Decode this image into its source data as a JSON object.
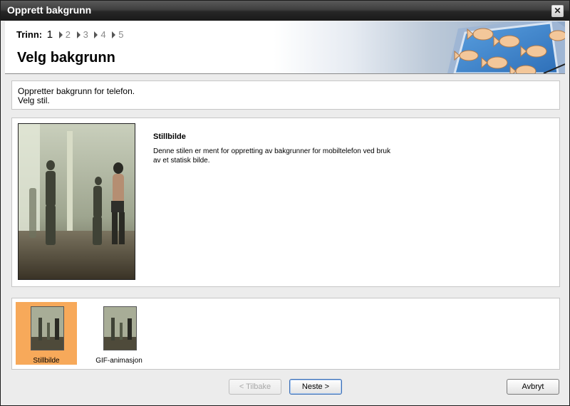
{
  "window": {
    "title": "Opprett bakgrunn"
  },
  "wizard": {
    "steps_label": "Trinn:",
    "current_step": "1",
    "other_steps": [
      "2",
      "3",
      "4",
      "5"
    ],
    "page_title": "Velg bakgrunn"
  },
  "description": {
    "line1": "Oppretter bakgrunn for telefon.",
    "line2": "Velg stil."
  },
  "preview": {
    "style_name": "Stillbilde",
    "style_description": "Denne stilen er ment for oppretting av bakgrunner for mobiltelefon ved bruk av et statisk bilde."
  },
  "styles": [
    {
      "label": "Stillbilde",
      "selected": true
    },
    {
      "label": "GIF-animasjon",
      "selected": false
    }
  ],
  "buttons": {
    "back": "< Tilbake",
    "next": "Neste >",
    "cancel": "Avbryt"
  },
  "icons": {
    "close": "close-icon"
  },
  "colors": {
    "selection": "#f7a95a",
    "titlebar": "#2a2a2a"
  }
}
